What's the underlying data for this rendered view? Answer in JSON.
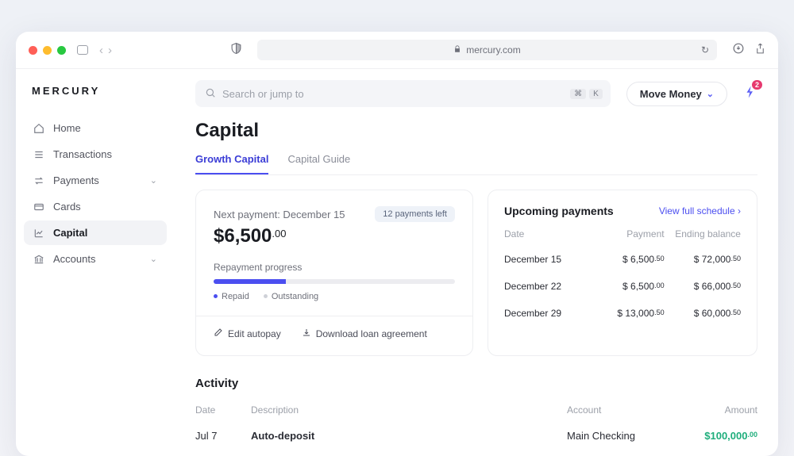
{
  "browser": {
    "url_host": "mercury.com"
  },
  "brand": "MERCURY",
  "sidebar": {
    "items": [
      {
        "label": "Home"
      },
      {
        "label": "Transactions"
      },
      {
        "label": "Payments"
      },
      {
        "label": "Cards"
      },
      {
        "label": "Capital"
      },
      {
        "label": "Accounts"
      }
    ]
  },
  "topbar": {
    "search_placeholder": "Search or jump to",
    "kbd1": "⌘",
    "kbd2": "K",
    "move_money": "Move Money",
    "notif_count": "2"
  },
  "page": {
    "title": "Capital"
  },
  "tabs": {
    "growth": "Growth Capital",
    "guide": "Capital Guide"
  },
  "next_payment": {
    "label": "Next payment: December 15",
    "pill": "12 payments left",
    "amount_main": "$6,500",
    "amount_cents": ".00",
    "progress_label": "Repayment progress",
    "legend_repaid": "Repaid",
    "legend_outstanding": "Outstanding",
    "edit_autopay": "Edit autopay",
    "download": "Download loan agreement"
  },
  "upcoming": {
    "title": "Upcoming payments",
    "view_full": "View full schedule",
    "head_date": "Date",
    "head_payment": "Payment",
    "head_balance": "Ending balance",
    "rows": [
      {
        "date": "December 15",
        "pay": "$ 6,500",
        "payc": ".50",
        "bal": "$ 72,000",
        "balc": ".50"
      },
      {
        "date": "December 22",
        "pay": "$ 6,500",
        "payc": ".00",
        "bal": "$ 66,000",
        "balc": ".50"
      },
      {
        "date": "December 29",
        "pay": "$ 13,000",
        "payc": ".50",
        "bal": "$ 60,000",
        "balc": ".50"
      }
    ]
  },
  "activity": {
    "title": "Activity",
    "head_date": "Date",
    "head_desc": "Description",
    "head_acct": "Account",
    "head_amount": "Amount",
    "rows": [
      {
        "date": "Jul 7",
        "desc": "Auto-deposit",
        "acct": "Main Checking",
        "amt": "$100,000",
        "amtc": ".00"
      }
    ]
  }
}
